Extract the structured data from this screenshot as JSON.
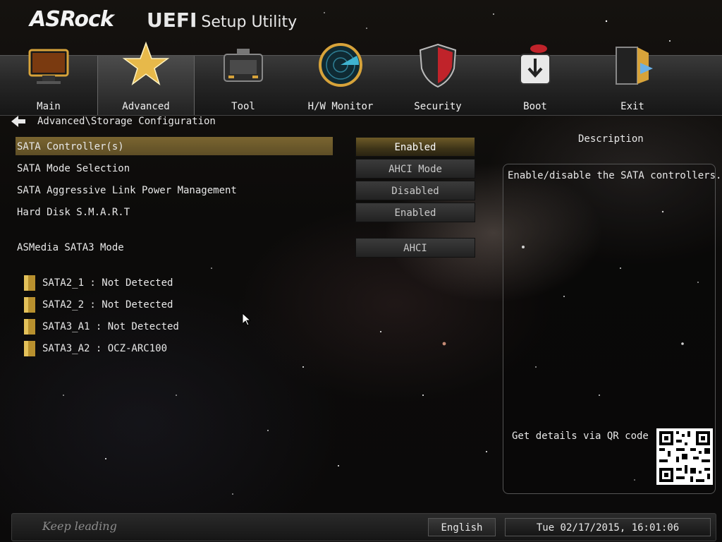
{
  "header": {
    "brand": "ASRock",
    "title_main": "UEFI",
    "title_sub": "Setup Utility"
  },
  "nav": {
    "active": "Advanced",
    "tabs": [
      {
        "label": "Main",
        "icon": "monitor-icon"
      },
      {
        "label": "Advanced",
        "icon": "star-icon"
      },
      {
        "label": "Tool",
        "icon": "toolbox-icon"
      },
      {
        "label": "H/W Monitor",
        "icon": "radar-icon"
      },
      {
        "label": "Security",
        "icon": "shield-icon"
      },
      {
        "label": "Boot",
        "icon": "boot-arrow-icon"
      },
      {
        "label": "Exit",
        "icon": "exit-door-icon"
      }
    ]
  },
  "breadcrumb": "Advanced\\Storage Configuration",
  "settings": [
    {
      "label": "SATA Controller(s)",
      "value": "Enabled",
      "selected": true
    },
    {
      "label": "SATA Mode Selection",
      "value": "AHCI Mode"
    },
    {
      "label": "SATA Aggressive Link Power Management",
      "value": "Disabled"
    },
    {
      "label": "Hard Disk S.M.A.R.T",
      "value": "Enabled"
    },
    {
      "label": "ASMedia SATA3 Mode",
      "value": "AHCI"
    }
  ],
  "disks": [
    {
      "label": "SATA2_1 : Not Detected",
      "icon": "folder-icon"
    },
    {
      "label": "SATA2_2 : Not Detected",
      "icon": "folder-icon"
    },
    {
      "label": "SATA3_A1 : Not Detected",
      "icon": "folder-icon"
    },
    {
      "label": "SATA3_A2 : OCZ-ARC100",
      "icon": "folder-icon"
    }
  ],
  "description": {
    "title": "Description",
    "text": "Enable/disable the SATA controllers.",
    "qr_text": "Get details via QR code"
  },
  "footer": {
    "tagline": "Keep leading",
    "language": "English",
    "datetime": "Tue 02/17/2015, 16:01:06"
  },
  "colors": {
    "highlight": "#6b5a2b",
    "accent_gold": "#d8b24a"
  }
}
